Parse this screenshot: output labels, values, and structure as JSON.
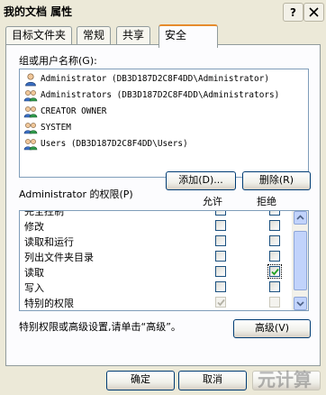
{
  "window": {
    "title": "我的文档 属性"
  },
  "tabs": [
    {
      "label": "目标文件夹"
    },
    {
      "label": "常规"
    },
    {
      "label": "共享"
    },
    {
      "label": "安全"
    }
  ],
  "security": {
    "group_label": "组或用户名称(G):",
    "users": [
      {
        "name": "Administrator (DB3D187D2C8F4DD\\Administrator)",
        "icon": "user-icon"
      },
      {
        "name": "Administrators (DB3D187D2C8F4DD\\Administrators)",
        "icon": "group-icon"
      },
      {
        "name": "CREATOR OWNER",
        "icon": "group-icon"
      },
      {
        "name": "SYSTEM",
        "icon": "group-icon"
      },
      {
        "name": "Users (DB3D187D2C8F4DD\\Users)",
        "icon": "group-icon"
      }
    ],
    "add_label": "添加(D)...",
    "remove_label": "删除(R)",
    "perm_label": "Administrator 的权限(P)",
    "allow_label": "允许",
    "deny_label": "拒绝",
    "permissions": [
      {
        "name": "修改",
        "allow": false,
        "deny": false,
        "disabled": false
      },
      {
        "name": "读取和运行",
        "allow": false,
        "deny": false,
        "disabled": false
      },
      {
        "name": "列出文件夹目录",
        "allow": false,
        "deny": false,
        "disabled": false
      },
      {
        "name": "读取",
        "allow": false,
        "deny": true,
        "disabled": false
      },
      {
        "name": "写入",
        "allow": false,
        "deny": false,
        "disabled": false
      },
      {
        "name": "特别的权限",
        "allow": true,
        "deny": false,
        "disabled": true
      }
    ],
    "advanced_hint": "特别权限或高级设置,请单击“高级”。",
    "advanced_label": "高级(V)"
  },
  "footer": {
    "ok_label": "确定",
    "cancel_label": "取消"
  },
  "watermark": "元计算",
  "colors": {
    "accent": "#e68b2c",
    "check": "#21a121",
    "border": "#7f9db9"
  }
}
